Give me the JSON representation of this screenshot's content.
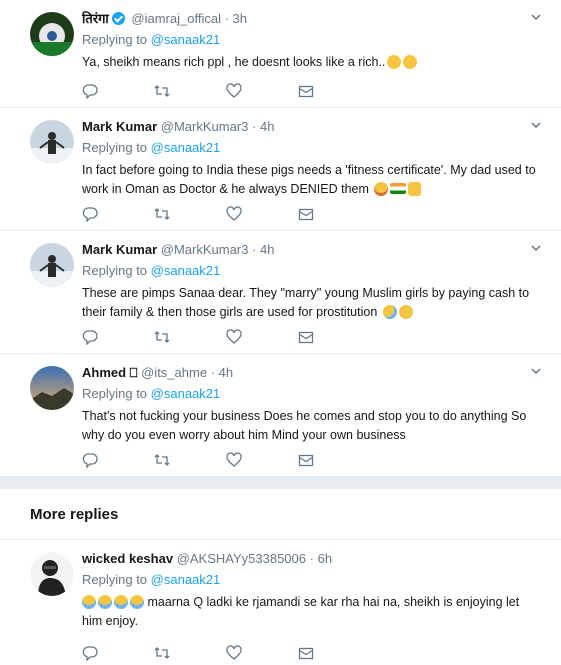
{
  "tweets": [
    {
      "name": "तिरंगा",
      "verified": true,
      "handle": "@iamraj_offical",
      "time": "3h",
      "replying_label": "Replying to",
      "replying_to": "@sanaak21",
      "text": "Ya, sheikh means rich ppl , he doesnt looks like a rich..",
      "emojis": [
        "think",
        "neutral"
      ]
    },
    {
      "name": "Mark Kumar",
      "verified": false,
      "handle": "@MarkKumar3",
      "time": "4h",
      "replying_label": "Replying to",
      "replying_to": "@sanaak21",
      "text": "In fact before going to India these pigs needs a 'fitness certificate'. My dad used to work in Oman as Doctor & he always DENIED them",
      "emojis": [
        "smile",
        "flag",
        "thumb"
      ]
    },
    {
      "name": "Mark Kumar",
      "verified": false,
      "handle": "@MarkKumar3",
      "time": "4h",
      "replying_label": "Replying to",
      "replying_to": "@sanaak21",
      "text": "These are pimps Sanaa dear. They \"marry\" young Muslim girls by paying cash to their family & then those girls are used for prostitution",
      "emojis": [
        "cry",
        "neutral"
      ]
    },
    {
      "name": "Ahmed ⎕",
      "verified": false,
      "handle": "@its_ahme",
      "time": "4h",
      "replying_label": "Replying to",
      "replying_to": "@sanaak21",
      "text": "That's not fucking your business Does he comes and stop you to do anything So why do you even worry about him Mind your own business",
      "emojis": []
    },
    {
      "name": "wicked keshav",
      "verified": false,
      "handle": "@AKSHAYy53385006",
      "time": "6h",
      "replying_label": "Replying to",
      "replying_to": "@sanaak21",
      "text": " maarna Q ladki ke rjamandi se kar rha  hai na, sheikh is enjoying let him enjoy.",
      "emojis_lead": [
        "laugh",
        "laugh",
        "laugh",
        "laugh"
      ]
    }
  ],
  "sections": {
    "more_replies": "More replies"
  },
  "icons": {
    "reply": "reply-icon",
    "retweet": "retweet-icon",
    "like": "heart-icon",
    "dm": "envelope-icon",
    "menu": "chevron-down-icon"
  },
  "colors": {
    "link": "#1da1f2",
    "muted": "#657786",
    "divider": "#e6ecf0"
  }
}
